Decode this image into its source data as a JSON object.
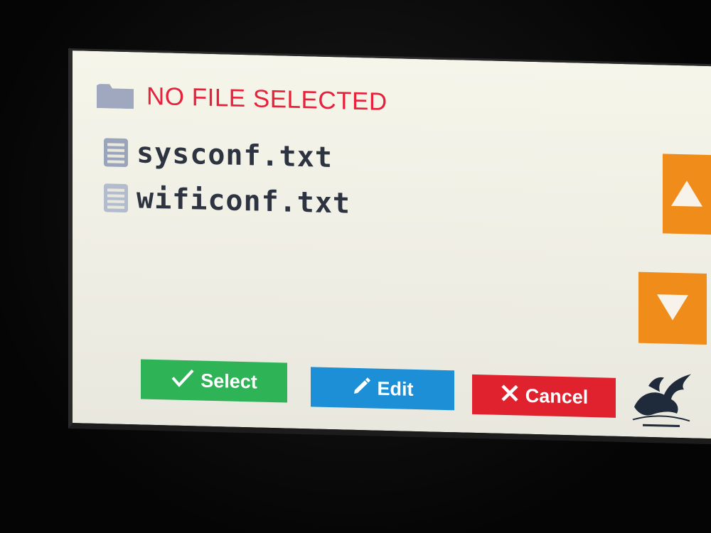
{
  "header": {
    "status": "NO FILE SELECTED",
    "icon": "folder-icon"
  },
  "files": [
    {
      "name": "sysconf.txt",
      "icon": "file-list-icon"
    },
    {
      "name": "wificonf.txt",
      "icon": "file-list-icon"
    }
  ],
  "buttons": {
    "select": {
      "label": "Select",
      "icon": "check-icon",
      "color": "#2eb357"
    },
    "edit": {
      "label": "Edit",
      "icon": "pencil-icon",
      "color": "#1d8fd6"
    },
    "cancel": {
      "label": "Cancel",
      "icon": "x-icon",
      "color": "#e0222e"
    }
  },
  "scroll": {
    "up_icon": "arrow-up-icon",
    "down_icon": "arrow-down-icon",
    "color": "#f08c1a"
  },
  "colors": {
    "status_text": "#e8213a",
    "file_text": "#2d3340",
    "screen_bg": "#f5f5ea"
  },
  "brand": {
    "icon": "flying-bear-logo"
  }
}
